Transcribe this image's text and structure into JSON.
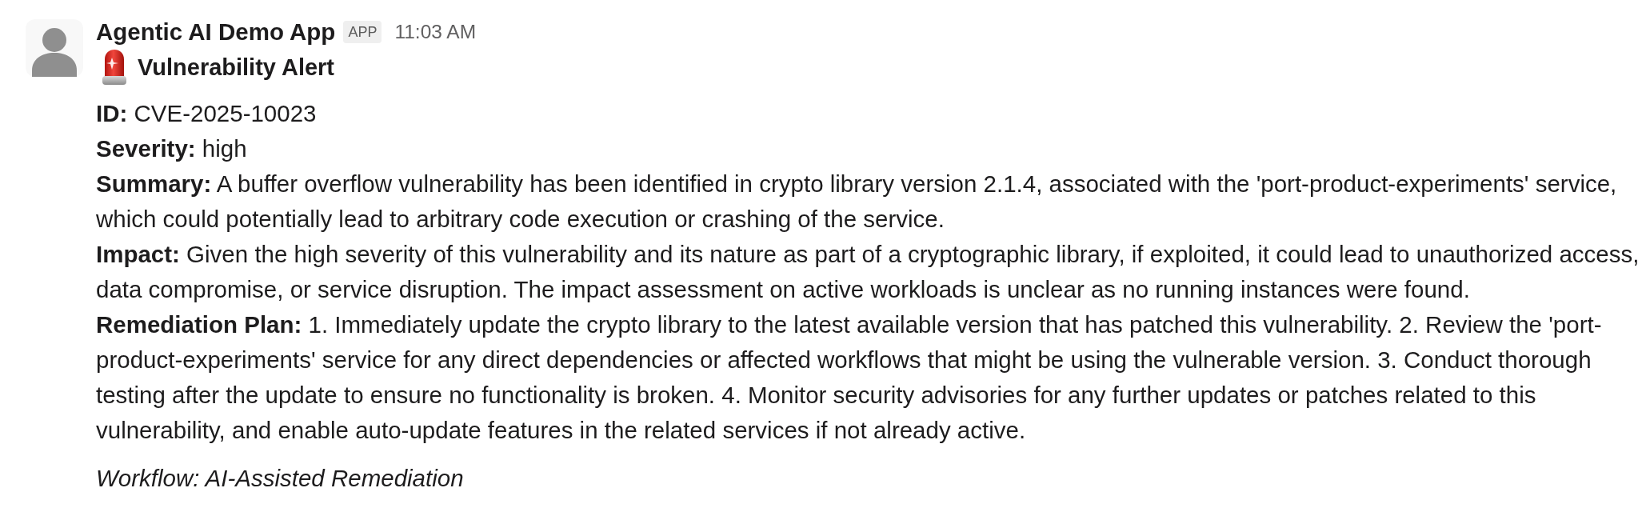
{
  "message": {
    "sender": "Agentic AI Demo App",
    "badge": "APP",
    "time": "11:03 AM",
    "title": "Vulnerability Alert",
    "fields": [
      "**ID:** CVE-2025-10023",
      "**Severity:** high",
      "**Summary:** A buffer overflow vulnerability has been identified in crypto library version 2.1.4, associated with the 'port-product-experiments' service, which could potentially lead to arbitrary code execution or crashing of the service.",
      "**Impact:** Given the high severity of this vulnerability and its nature as part of a cryptographic library, if exploited, it could lead to unauthorized access, data compromise, or service disruption. The impact assessment on active workloads is unclear as no running instances were found.",
      "**Remediation Plan:** 1. Immediately update the crypto library to the latest available version that has patched this vulnerability. 2. Review the 'port-product-experiments' service for any direct dependencies or affected workflows that might be using the vulnerable version. 3. Conduct thorough testing after the update to ensure no functionality is broken. 4. Monitor security advisories for any further updates or patches related to this vulnerability, and enable auto-update features in the related services if not already active."
    ],
    "context": "Workflow: AI-Assisted Remediation"
  }
}
